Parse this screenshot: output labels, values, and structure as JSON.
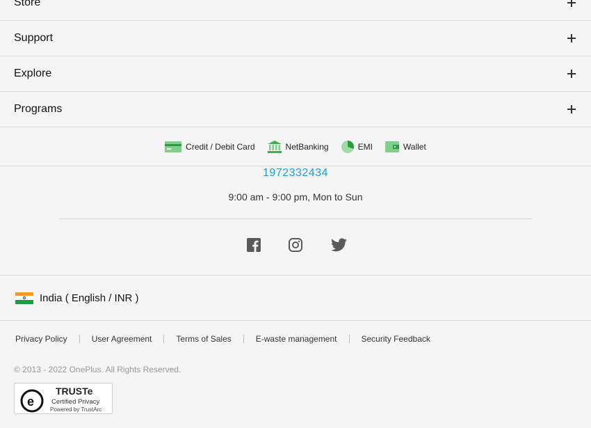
{
  "accordion": [
    {
      "label": "Store"
    },
    {
      "label": "Support"
    },
    {
      "label": "Explore"
    },
    {
      "label": "Programs"
    }
  ],
  "payments": [
    {
      "label": "Credit / Debit Card",
      "icon": "credit-card-icon"
    },
    {
      "label": "NetBanking",
      "icon": "bank-icon"
    },
    {
      "label": "EMI",
      "icon": "pie-chart-icon"
    },
    {
      "label": "Wallet",
      "icon": "wallet-icon"
    }
  ],
  "contact": {
    "phone": "1972332434",
    "hours": "9:00 am - 9:00 pm, Mon to Sun"
  },
  "social": [
    {
      "icon": "facebook-icon"
    },
    {
      "icon": "instagram-icon"
    },
    {
      "icon": "twitter-icon"
    }
  ],
  "region": {
    "label": "India ( English / INR )",
    "flag": "india-flag-icon"
  },
  "legal_links": [
    {
      "label": "Privacy Policy"
    },
    {
      "label": "User Agreement"
    },
    {
      "label": "Terms of Sales"
    },
    {
      "label": "E-waste management"
    },
    {
      "label": "Security Feedback"
    }
  ],
  "copyright": "© 2013 - 2022 OnePlus. All Rights Reserved.",
  "badge": {
    "title": "TRUSTe",
    "subtitle": "Certified Privacy",
    "powered": "Powered by TrustArc"
  },
  "colors": {
    "accent": "#1a9fd6",
    "payment_icon_green": "#3cb04a"
  }
}
